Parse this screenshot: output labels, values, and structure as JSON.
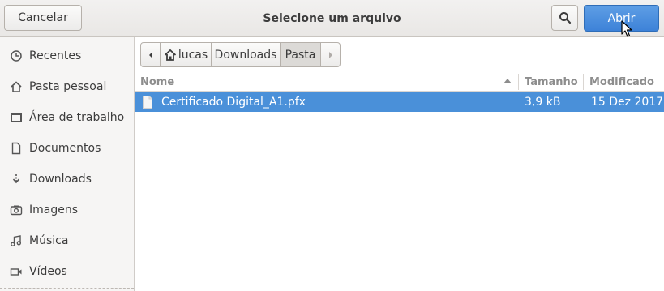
{
  "header": {
    "cancel_label": "Cancelar",
    "title": "Selecione um arquivo",
    "open_label": "Abrir"
  },
  "sidebar": {
    "items": [
      {
        "label": "Recentes",
        "icon": "clock-icon"
      },
      {
        "label": "Pasta pessoal",
        "icon": "home-icon"
      },
      {
        "label": "Área de trabalho",
        "icon": "desktop-folder-icon"
      },
      {
        "label": "Documentos",
        "icon": "document-icon"
      },
      {
        "label": "Downloads",
        "icon": "download-icon"
      },
      {
        "label": "Imagens",
        "icon": "camera-icon"
      },
      {
        "label": "Música",
        "icon": "music-icon"
      },
      {
        "label": "Vídeos",
        "icon": "video-icon"
      }
    ]
  },
  "pathbar": {
    "crumbs": [
      "lucas",
      "Downloads",
      "Pasta"
    ],
    "active": "Pasta"
  },
  "list": {
    "columns": {
      "name": "Nome",
      "size": "Tamanho",
      "modified": "Modificado"
    },
    "sort": "Nome ascending",
    "rows": [
      {
        "name": "Certificado Digital_A1.pfx",
        "size": "3,9 kB",
        "modified": "15 Dez 2017",
        "selected": true
      }
    ]
  },
  "colors": {
    "selection": "#4a90d9",
    "suggested_action": "#3d82d8",
    "headerbar": "#ece9e6"
  }
}
